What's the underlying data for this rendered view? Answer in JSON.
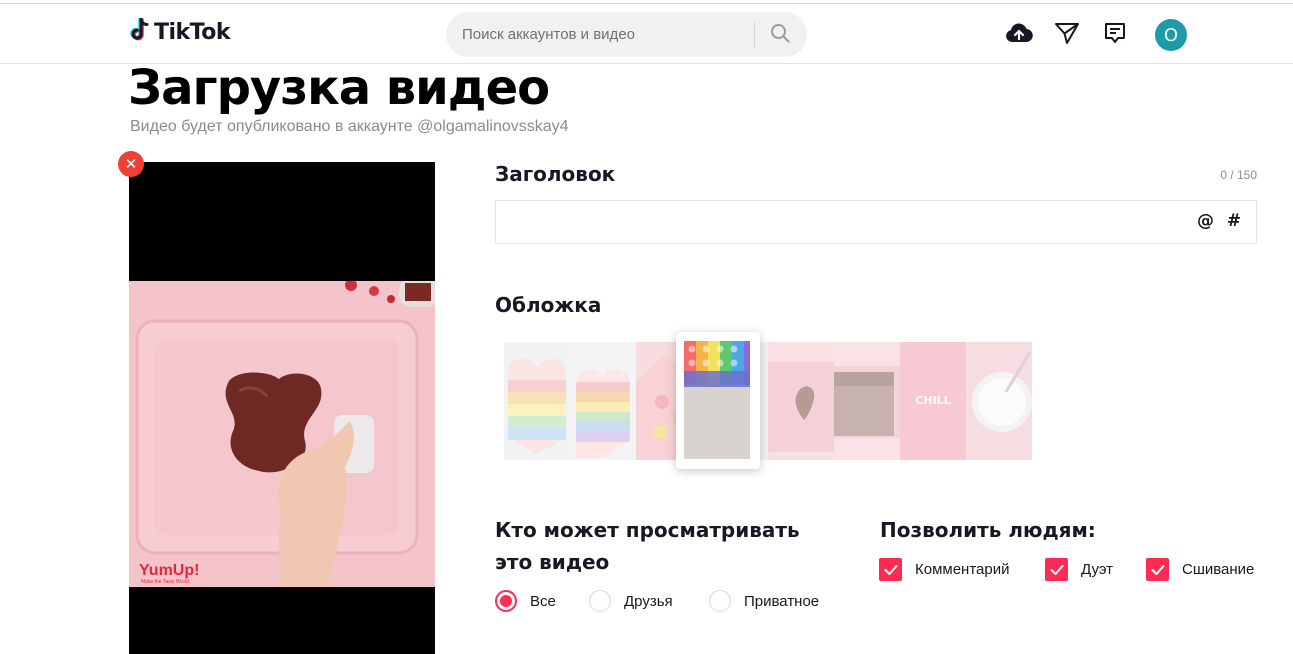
{
  "header": {
    "logo_text": "TikTok",
    "search_placeholder": "Поиск аккаунтов и видео",
    "avatar_letter": "O"
  },
  "page": {
    "title": "Загрузка видео",
    "subtitle": "Видео будет опубликовано в аккаунте @olgamalinovsskay4"
  },
  "video": {
    "watermark": "YumUp!",
    "watermark_tagline": "Make the Tasty World"
  },
  "caption": {
    "label": "Заголовок",
    "counter": "0 / 150",
    "value": "",
    "mention_symbol": "@",
    "hashtag_symbol": "#"
  },
  "cover": {
    "label": "Обложка",
    "thumb_text": "CHILL"
  },
  "visibility": {
    "label_line1": "Кто может просматривать",
    "label_line2": "это видео",
    "options": [
      {
        "label": "Все",
        "selected": true
      },
      {
        "label": "Друзья",
        "selected": false
      },
      {
        "label": "Приватное",
        "selected": false
      }
    ]
  },
  "permissions": {
    "label": "Позволить людям:",
    "options": [
      {
        "label": "Комментарий",
        "checked": true
      },
      {
        "label": "Дуэт",
        "checked": true
      },
      {
        "label": "Сшивание",
        "checked": true
      }
    ]
  },
  "colors": {
    "accent": "#fe2c55",
    "avatar_bg": "#1e9ba6",
    "close_button": "#ee4136"
  }
}
